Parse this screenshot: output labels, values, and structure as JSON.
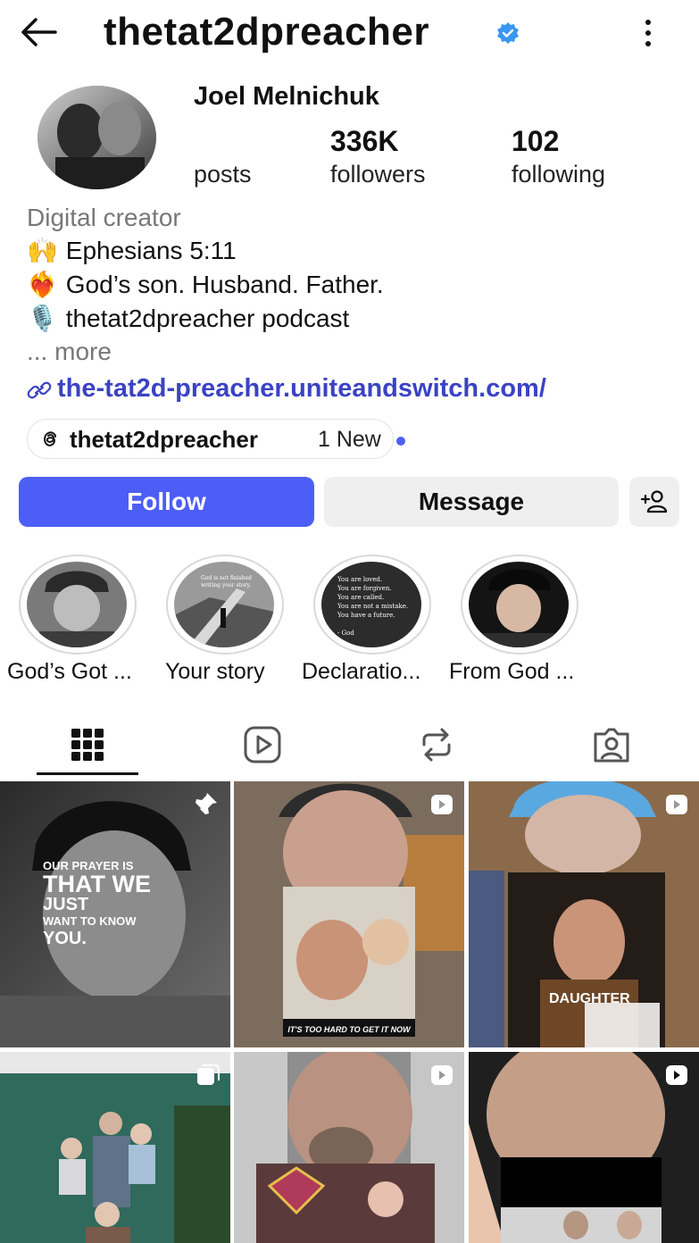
{
  "header": {
    "username": "thetat2dpreacher",
    "verified": true,
    "icons": [
      "back-arrow-icon",
      "verified-badge-icon",
      "more-vertical-icon"
    ]
  },
  "profile": {
    "full_name": "Joel Melnichuk",
    "stats": {
      "posts_value": "",
      "posts_label": "posts",
      "followers_value": "336K",
      "followers_label": "followers",
      "following_value": "102",
      "following_label": "following"
    },
    "category": "Digital creator",
    "bio_lines": [
      {
        "emoji": "🙌",
        "text": "Ephesians 5:11"
      },
      {
        "emoji": "❤️‍🔥",
        "text": "God’s son. Husband. Father."
      },
      {
        "emoji": "🎙️",
        "text": "thetat2dpreacher podcast"
      }
    ],
    "more_label": "... more",
    "link": "the-tat2d-preacher.uniteandswitch.com/",
    "threads": {
      "name": "thetat2dpreacher",
      "new_label": "1 New"
    }
  },
  "actions": {
    "follow_label": "Follow",
    "message_label": "Message",
    "accent": "#4d5ef6"
  },
  "highlights": [
    {
      "label": "God’s Got ..."
    },
    {
      "label": "Your story"
    },
    {
      "label": "Declaratio..."
    },
    {
      "label": "From God ..."
    }
  ],
  "highlight_texts": {
    "story2": [
      "God is not finished",
      "writing your story."
    ],
    "story3": [
      "You are loved.",
      "You are forgiven.",
      "You are called.",
      "You are not a mistake.",
      "You have a future.",
      "",
      "- God"
    ]
  },
  "tabs": [
    {
      "icon": "grid-icon",
      "active": true
    },
    {
      "icon": "reels-icon",
      "active": false
    },
    {
      "icon": "reposts-icon",
      "active": false
    },
    {
      "icon": "tagged-icon",
      "active": false
    }
  ],
  "posts": {
    "post1_lines": [
      "OUR PRAYER IS",
      "THAT WE",
      "JUST",
      "WANT TO KNOW",
      "YOU."
    ],
    "post2_caption": "IT'S TOO HARD TO GET IT NOW",
    "post3_caption": "DAUGHTER"
  }
}
